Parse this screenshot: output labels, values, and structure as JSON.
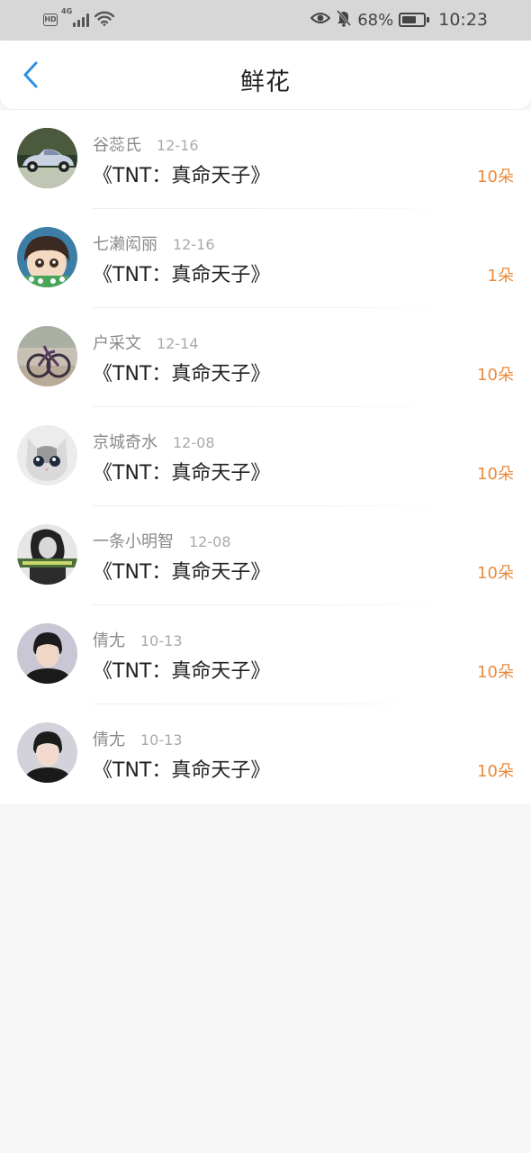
{
  "status_bar": {
    "hd": "HD",
    "network": "4G",
    "battery_percent": "68%",
    "battery_level": 0.68,
    "time": "10:23",
    "icons": [
      "signal-icon",
      "wifi-icon",
      "eye-icon",
      "bell-muted-icon",
      "battery-icon"
    ]
  },
  "header": {
    "title": "鲜花",
    "back_icon": "chevron-left-icon",
    "accent": "#2f8fe0"
  },
  "colors": {
    "count": "#e98a3c"
  },
  "items": [
    {
      "name": "谷蕊氏",
      "date": "12-16",
      "title": "《TNT：真命天子》",
      "count": "10朵"
    },
    {
      "name": "七濑闳丽",
      "date": "12-16",
      "title": "《TNT：真命天子》",
      "count": "1朵"
    },
    {
      "name": "户采文",
      "date": "12-14",
      "title": "《TNT：真命天子》",
      "count": "10朵"
    },
    {
      "name": "京城奇水",
      "date": "12-08",
      "title": "《TNT：真命天子》",
      "count": "10朵"
    },
    {
      "name": "一条小明智",
      "date": "12-08",
      "title": "《TNT：真命天子》",
      "count": "10朵"
    },
    {
      "name": "倩尢",
      "date": "10-13",
      "title": "《TNT：真命天子》",
      "count": "10朵"
    },
    {
      "name": "倩尢",
      "date": "10-13",
      "title": "《TNT：真命天子》",
      "count": "10朵"
    }
  ]
}
